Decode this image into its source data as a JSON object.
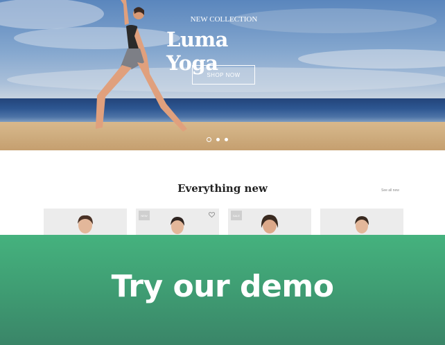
{
  "hero": {
    "eyebrow": "NEW COLLECTION",
    "title": "Luma Yoga",
    "button_label": "SHOP NOW",
    "slides": 3,
    "active_slide": 1
  },
  "products": {
    "heading": "Everything new",
    "see_all_label": "See all new",
    "cards": [
      {
        "badge": ""
      },
      {
        "badge": "NEW"
      },
      {
        "badge": "SALE"
      },
      {
        "badge": ""
      }
    ]
  },
  "cta": {
    "label": "Try our demo",
    "colors": {
      "top": "#45b27e",
      "bottom": "#3a8568"
    }
  }
}
